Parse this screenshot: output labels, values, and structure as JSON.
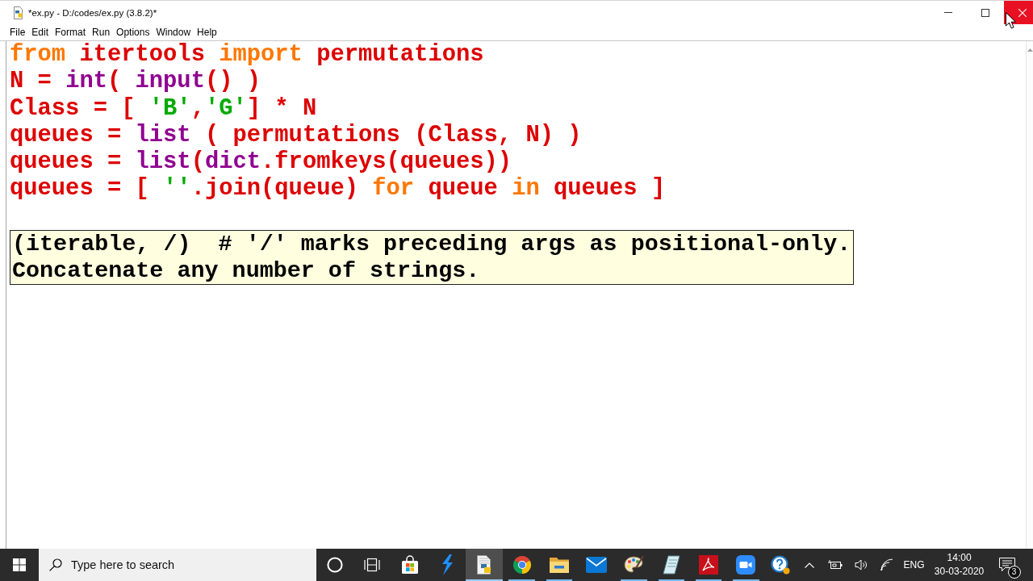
{
  "window": {
    "title": "*ex.py - D:/codes/ex.py (3.8.2)*",
    "close_hovered": true
  },
  "menu": [
    "File",
    "Edit",
    "Format",
    "Run",
    "Options",
    "Window",
    "Help"
  ],
  "editor": {
    "lines": [
      [
        {
          "kind": "keyword",
          "text": "from"
        },
        {
          "kind": "normal",
          "text": " itertools "
        },
        {
          "kind": "keyword",
          "text": "import"
        },
        {
          "kind": "normal",
          "text": " permutations"
        }
      ],
      [
        {
          "kind": "normal",
          "text": "N = "
        },
        {
          "kind": "builtin",
          "text": "int"
        },
        {
          "kind": "normal",
          "text": "( "
        },
        {
          "kind": "builtin",
          "text": "input"
        },
        {
          "kind": "normal",
          "text": "() )"
        }
      ],
      [
        {
          "kind": "normal",
          "text": "Class = [ "
        },
        {
          "kind": "string",
          "text": "'B'"
        },
        {
          "kind": "normal",
          "text": ","
        },
        {
          "kind": "string",
          "text": "'G'"
        },
        {
          "kind": "normal",
          "text": "] * N"
        }
      ],
      [
        {
          "kind": "normal",
          "text": "queues = "
        },
        {
          "kind": "builtin",
          "text": "list"
        },
        {
          "kind": "normal",
          "text": " ( permutations (Class, N) )"
        }
      ],
      [
        {
          "kind": "normal",
          "text": "queues = "
        },
        {
          "kind": "builtin",
          "text": "list"
        },
        {
          "kind": "normal",
          "text": "("
        },
        {
          "kind": "builtin",
          "text": "dict"
        },
        {
          "kind": "normal",
          "text": ".fromkeys(queues))"
        }
      ],
      [
        {
          "kind": "normal",
          "text": "queues = [ "
        },
        {
          "kind": "string",
          "text": "''"
        },
        {
          "kind": "normal",
          "text": ".join(queue) "
        },
        {
          "kind": "keyword",
          "text": "for"
        },
        {
          "kind": "normal",
          "text": " queue "
        },
        {
          "kind": "keyword",
          "text": "in"
        },
        {
          "kind": "normal",
          "text": " queues ]"
        }
      ]
    ]
  },
  "calltip": {
    "lines": [
      "(iterable, /)  # '/' marks preceding args as positional-only.",
      "Concatenate any number of strings."
    ]
  },
  "taskbar": {
    "search": {
      "placeholder": "Type here to search"
    },
    "apps": [
      {
        "kind": "assistant",
        "running": false,
        "selected": false
      },
      {
        "kind": "taskview",
        "running": false,
        "selected": false
      },
      {
        "kind": "store",
        "running": false,
        "selected": false
      },
      {
        "kind": "bolt",
        "running": false,
        "selected": false
      },
      {
        "kind": "python",
        "running": true,
        "selected": true
      },
      {
        "kind": "browser",
        "running": true,
        "selected": false
      },
      {
        "kind": "folder",
        "running": true,
        "selected": false
      },
      {
        "kind": "mail",
        "running": false,
        "selected": false
      },
      {
        "kind": "paint",
        "running": true,
        "selected": false
      },
      {
        "kind": "notes",
        "running": true,
        "selected": false
      },
      {
        "kind": "pdf",
        "running": true,
        "selected": false
      },
      {
        "kind": "video",
        "running": true,
        "selected": false
      }
    ],
    "tray": {
      "language": "ENG",
      "time": "14:00",
      "date": "30-03-2020",
      "notifications": "3"
    }
  }
}
